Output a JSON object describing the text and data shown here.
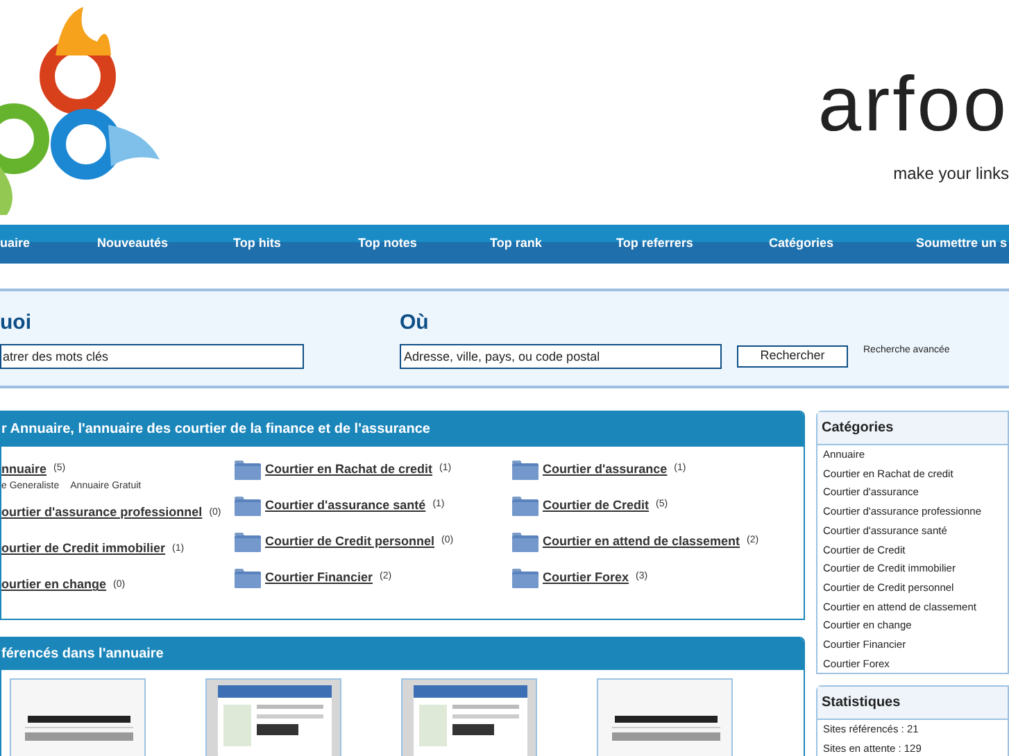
{
  "header": {
    "logo_text": "arfoo",
    "tagline": "make your links"
  },
  "nav": [
    "uaire",
    "Nouveautés",
    "Top hits",
    "Top notes",
    "Top rank",
    "Top referrers",
    "Catégories",
    "Soumettre un s"
  ],
  "search": {
    "what_label": "uoi",
    "what_placeholder": "atrer des mots clés",
    "where_label": "Où",
    "where_placeholder": "Adresse, ville, pays, ou code postal",
    "button": "Rechercher",
    "advanced": "Recherche avancée"
  },
  "directory": {
    "title": "r Annuaire, l'annuaire des courtier de la finance et de l'assurance",
    "columns": [
      [
        {
          "name": "nnuaire",
          "count": "(5)",
          "subcategories": [
            "e Generaliste",
            "Annuaire Gratuit"
          ]
        },
        {
          "name": "ourtier d'assurance professionnel",
          "count": "(0)"
        },
        {
          "name": "ourtier de Credit immobilier",
          "count": "(1)"
        },
        {
          "name": "ourtier en change",
          "count": "(0)"
        }
      ],
      [
        {
          "name": "Courtier en Rachat de credit",
          "count": "(1)"
        },
        {
          "name": "Courtier d'assurance santé",
          "count": "(1)"
        },
        {
          "name": "Courtier de Credit personnel",
          "count": "(0)"
        },
        {
          "name": "Courtier Financier",
          "count": "(2)"
        }
      ],
      [
        {
          "name": "Courtier d'assurance",
          "count": "(1)"
        },
        {
          "name": "Courtier de Credit",
          "count": "(5)"
        },
        {
          "name": "Courtier en attend de classement",
          "count": "(2)"
        },
        {
          "name": "Courtier Forex",
          "count": "(3)"
        }
      ]
    ]
  },
  "sites": {
    "title": "férencés dans l'annuaire",
    "thumbnails": [
      {
        "kind": "placeholder"
      },
      {
        "kind": "screenshot"
      },
      {
        "kind": "screenshot"
      },
      {
        "kind": "placeholder"
      }
    ]
  },
  "sidebar": {
    "categories_title": "Catégories",
    "categories": [
      "Annuaire",
      "Courtier en Rachat de credit",
      "Courtier d'assurance",
      "Courtier d'assurance professionne",
      "Courtier d'assurance santé",
      "Courtier de Credit",
      "Courtier de Credit immobilier",
      "Courtier de Credit personnel",
      "Courtier en attend de classement",
      "Courtier en change",
      "Courtier Financier",
      "Courtier Forex"
    ],
    "stats_title": "Statistiques",
    "stats": [
      "Sites référencés : 21",
      "Sites en attente : 129"
    ]
  }
}
